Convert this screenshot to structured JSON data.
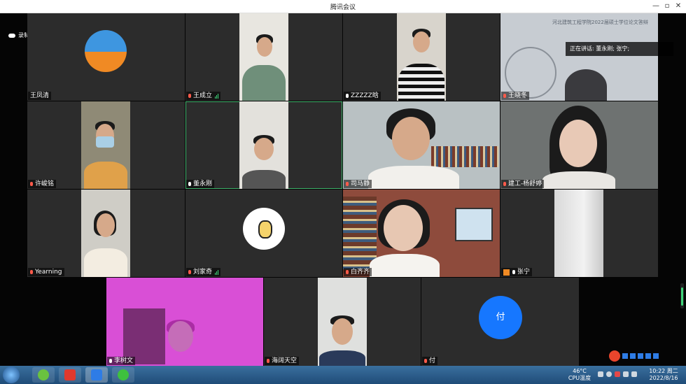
{
  "window": {
    "title": "腾讯会议"
  },
  "recording": {
    "label": "录制中"
  },
  "speaking": {
    "label": "正在讲话: 董永刚; 张宁;"
  },
  "banner": {
    "text": "河北建筑工程学院2022届硕士学位论文答辩"
  },
  "participants": [
    {
      "name": "王凤清",
      "mic": "none"
    },
    {
      "name": "王成立",
      "mic": "muted",
      "level": true
    },
    {
      "name": "ZZZZZ晗",
      "mic": "on"
    },
    {
      "name": "王晓冬",
      "mic": "muted"
    },
    {
      "name": "许峻铭",
      "mic": "muted"
    },
    {
      "name": "董永刚",
      "mic": "on"
    },
    {
      "name": "司马静",
      "mic": "muted"
    },
    {
      "name": "建工-杨舒婷",
      "mic": "muted"
    },
    {
      "name": "Yearning",
      "mic": "muted"
    },
    {
      "name": "刘家奇",
      "mic": "muted",
      "level": true
    },
    {
      "name": "白齐齐",
      "mic": "muted"
    },
    {
      "name": "张宁",
      "mic": "on"
    },
    {
      "name": "李树文",
      "mic": "on"
    },
    {
      "name": "海阔天空",
      "mic": "muted"
    },
    {
      "name": "付",
      "mic": "muted",
      "avatar": "付"
    }
  ],
  "taskbar": {
    "cpu_temp": "46°C",
    "cpu_label": "CPU温度",
    "time": "10:22 周二",
    "date": "2022/8/16"
  },
  "colors": {
    "avatar_blue": "#1677ff",
    "speaking_border": "#3fb36b",
    "muted_red": "#ff5a4a"
  }
}
